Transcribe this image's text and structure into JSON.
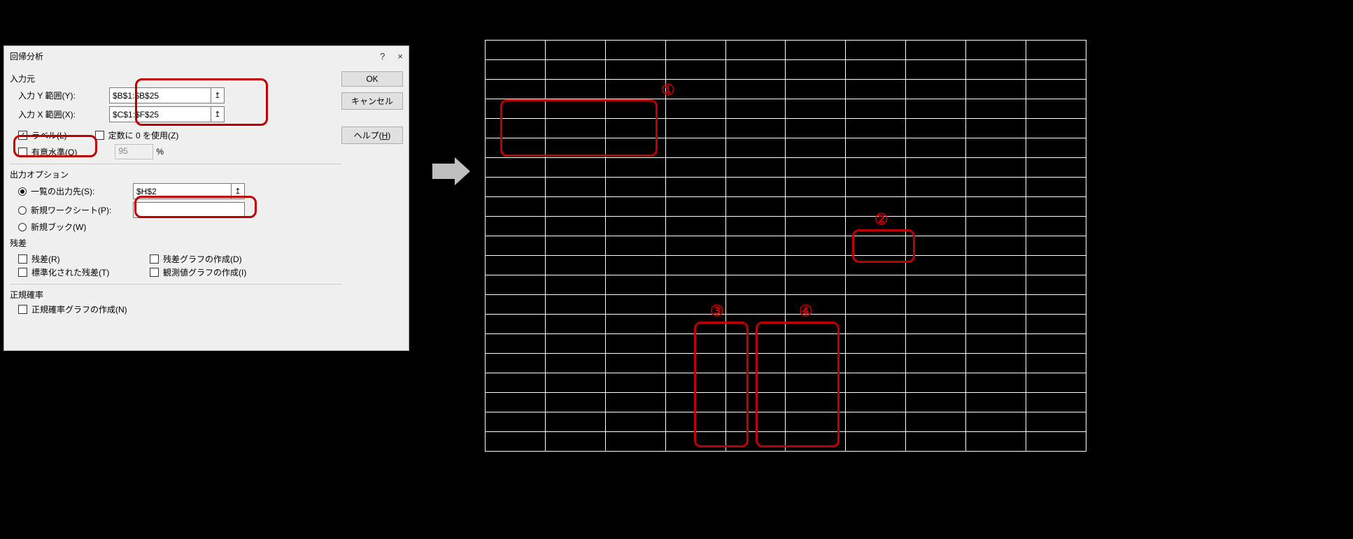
{
  "dialog": {
    "title": "回帰分析",
    "help_icon": "?",
    "close_icon": "×",
    "buttons": {
      "ok": "OK",
      "cancel": "キャンセル",
      "help": "ヘルプ(H)"
    },
    "input_section": {
      "label": "入力元",
      "y_label": "入力 Y 範囲(Y):",
      "y_value": "$B$1:$B$25",
      "x_label": "入力 X 範囲(X):",
      "x_value": "$C$1:$F$25",
      "labels_check": "ラベル(L)",
      "const_zero": "定数に 0 を使用(Z)",
      "signif": "有意水準(O)",
      "signif_value": "95",
      "pct": "%"
    },
    "output_section": {
      "label": "出力オプション",
      "out_range": "一覧の出力先(S):",
      "out_value": "$H$2",
      "new_ws": "新規ワークシート(P):",
      "new_wb": "新規ブック(W)"
    },
    "residuals": {
      "label": "残差",
      "resid": "残差(R)",
      "resid_plot": "残差グラフの作成(D)",
      "std_resid": "標準化された残差(T)",
      "obs_plot": "観測値グラフの作成(I)"
    },
    "normal": {
      "label": "正規確率",
      "np_plot": "正規確率グラフの作成(N)"
    }
  },
  "callouts": {
    "c1": "①",
    "c2": "②",
    "c3": "③",
    "c4": "④"
  }
}
